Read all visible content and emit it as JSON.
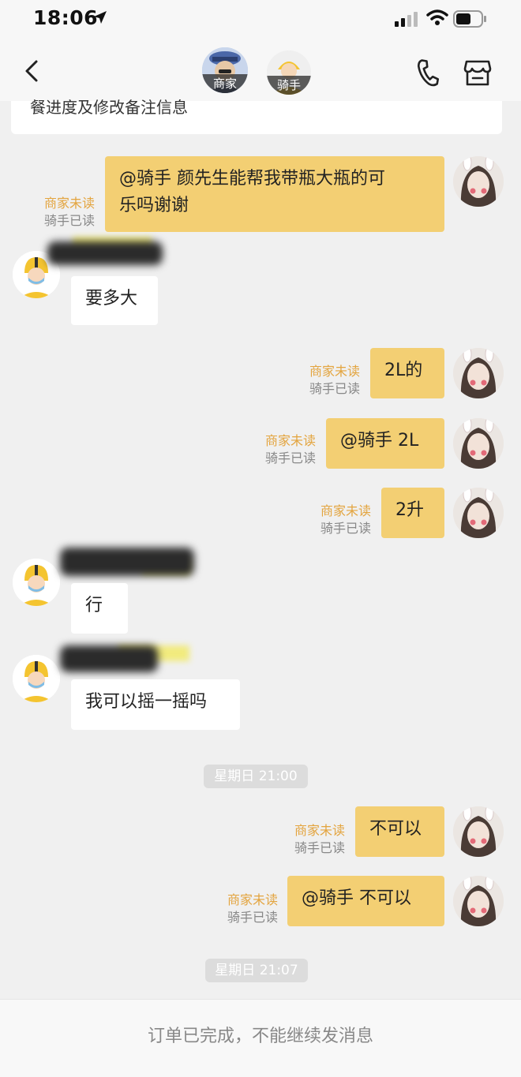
{
  "status_bar": {
    "time": "18:06"
  },
  "header": {
    "merchant_tag": "商家",
    "rider_tag": "骑手"
  },
  "info_card": {
    "text": "餐进度及修改备注信息"
  },
  "messages": [
    {
      "from": "me",
      "text_lines": [
        "@骑手 颜先生能帮我带瓶大瓶的可",
        "乐吗谢谢"
      ],
      "merchant_status": "商家未读",
      "rider_status": "骑手已读"
    },
    {
      "from": "rider",
      "text": "要多大"
    },
    {
      "from": "me",
      "text": "2L的",
      "merchant_status": "商家未读",
      "rider_status": "骑手已读"
    },
    {
      "from": "me",
      "text": "@骑手 2L",
      "merchant_status": "商家未读",
      "rider_status": "骑手已读"
    },
    {
      "from": "me",
      "text": "2升",
      "merchant_status": "商家未读",
      "rider_status": "骑手已读"
    },
    {
      "from": "rider",
      "text": "行"
    },
    {
      "from": "rider",
      "text": "我可以摇一摇吗"
    },
    {
      "from": "system",
      "text": "星期日 21:00"
    },
    {
      "from": "me",
      "text": "不可以",
      "merchant_status": "商家未读",
      "rider_status": "骑手已读"
    },
    {
      "from": "me",
      "text": "@骑手 不可以",
      "merchant_status": "商家未读",
      "rider_status": "骑手已读"
    },
    {
      "from": "system",
      "text": "星期日 21:07"
    }
  ],
  "footer": {
    "text": "订单已完成，不能继续发消息"
  },
  "colors": {
    "my_bubble": "#f3cf73",
    "unread_text": "#e3a43e",
    "background": "#f0f0f0"
  },
  "icons": [
    "location-arrow-icon",
    "signal-icon",
    "wifi-icon",
    "battery-icon",
    "back-icon",
    "phone-icon",
    "store-icon"
  ]
}
